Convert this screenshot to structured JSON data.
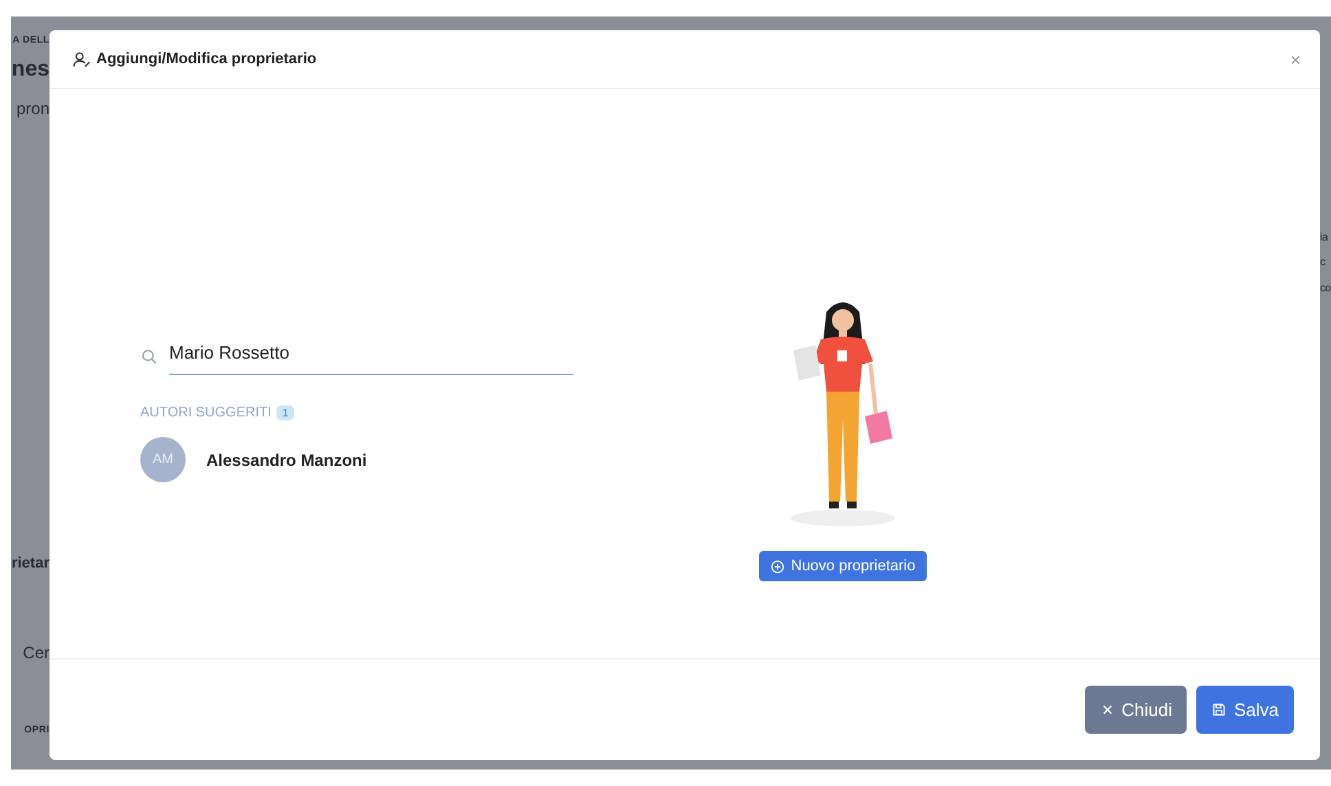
{
  "background_fragments": {
    "left": [
      "A DELL",
      "nes",
      "pron",
      "rietar",
      "Cer",
      "OPRI"
    ],
    "right": [
      "ia",
      "c",
      "co"
    ]
  },
  "dialog": {
    "title": "Aggiungi/Modifica proprietario",
    "close": "×"
  },
  "search": {
    "value": "Mario Rossetto"
  },
  "suggestions": {
    "heading": "AUTORI SUGGERITI",
    "count": "1",
    "items": [
      {
        "initials": "AM",
        "name": "Alessandro Manzoni"
      }
    ]
  },
  "new_owner_button": "Nuovo proprietario",
  "buttons": [
    {
      "kind": "close",
      "label": "Chiudi"
    },
    {
      "kind": "save",
      "label": "Salva"
    }
  ]
}
